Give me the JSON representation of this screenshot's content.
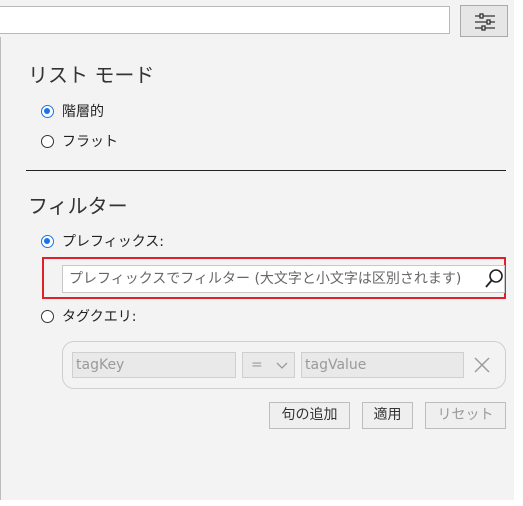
{
  "top_search": {
    "value": ""
  },
  "list_mode": {
    "title": "リスト モード",
    "options": [
      {
        "label": "階層的",
        "checked": true
      },
      {
        "label": "フラット",
        "checked": false
      }
    ]
  },
  "filter": {
    "title": "フィルター",
    "prefix_label": "プレフィックス:",
    "prefix_placeholder": "プレフィックスでフィルター (大文字と小文字は区別されます)",
    "tag_query_label": "タグクエリ:",
    "tag_key_placeholder": "tagKey",
    "operator": "=",
    "tag_value_placeholder": "tagValue",
    "buttons": {
      "add_clause": "句の追加",
      "apply": "適用",
      "reset": "リセット"
    }
  },
  "colors": {
    "accent": "#1a73e8",
    "highlight": "#e0202a"
  }
}
